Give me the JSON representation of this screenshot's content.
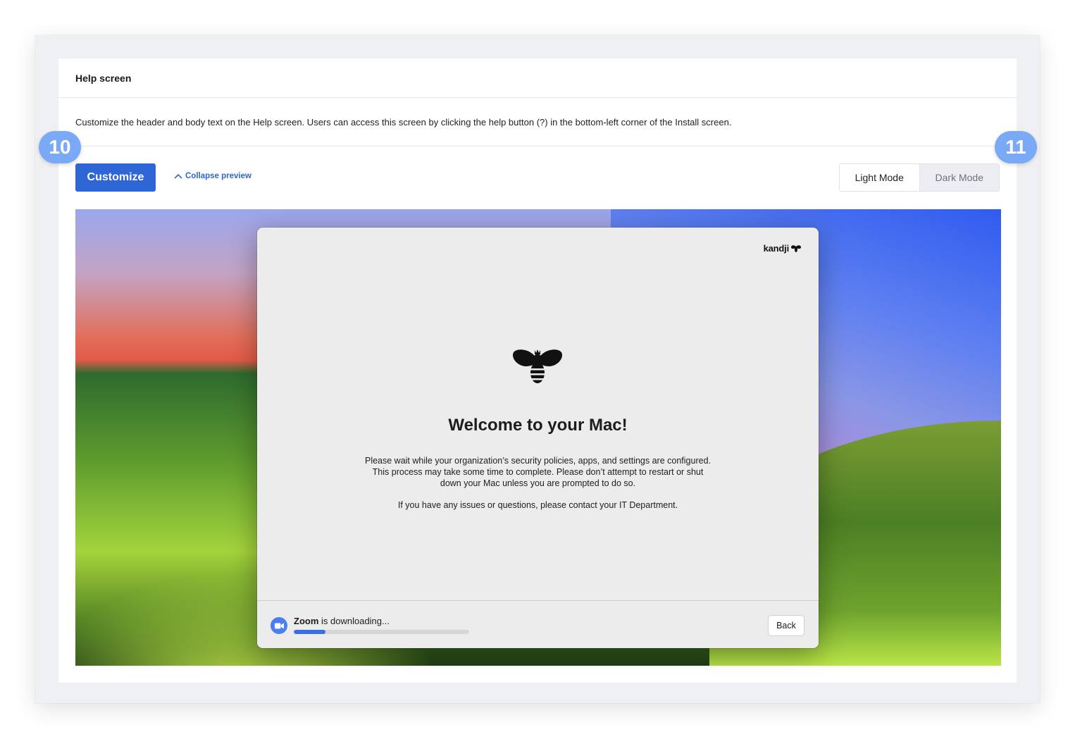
{
  "card": {
    "title": "Help screen",
    "description": "Customize the header and body text on the Help screen. Users can access this screen by clicking the help button (?) in the bottom-left corner of the Install screen."
  },
  "toolbar": {
    "customize_label": "Customize",
    "collapse_label": "Collapse preview",
    "modes": [
      "Light Mode",
      "Dark Mode"
    ],
    "active_mode": "Light Mode"
  },
  "callouts": {
    "left": "10",
    "right": "11"
  },
  "dialog": {
    "brand": "kandji",
    "title": "Welcome to your Mac!",
    "body": "Please wait while your organization’s security policies, apps, and settings are configured. This process may take some time to complete. Please don’t attempt to restart or shut down your Mac unless you are prompted to do so.",
    "contact": "If you have any issues or questions, please contact your IT Department.",
    "download": {
      "app_name": "Zoom",
      "status": "is downloading...",
      "progress": 0.18
    },
    "back_label": "Back"
  },
  "colors": {
    "primary": "#2f66d6",
    "badge": "#7aa9f5",
    "progress": "#3b6fe0"
  }
}
